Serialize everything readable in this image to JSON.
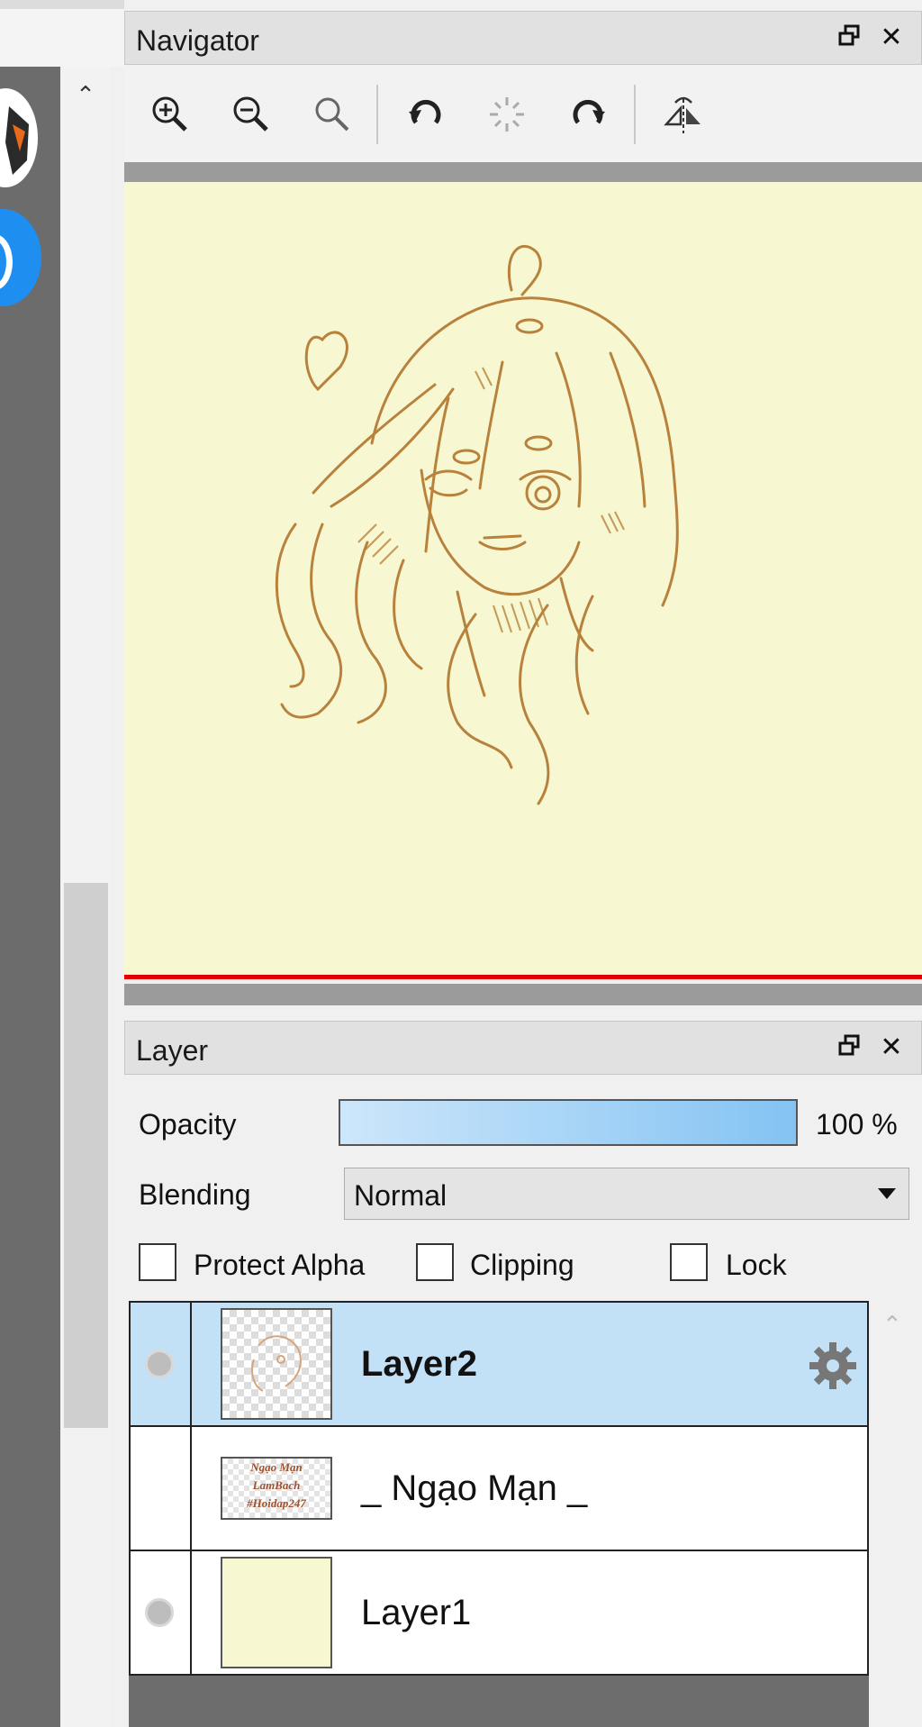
{
  "navigator": {
    "title": "Navigator",
    "toolbar": [
      {
        "icon": "zoom-in-icon"
      },
      {
        "icon": "zoom-out-icon"
      },
      {
        "icon": "zoom-reset-icon"
      },
      {
        "icon": "rotate-left-icon"
      },
      {
        "icon": "rotate-reset-icon"
      },
      {
        "icon": "rotate-right-icon"
      },
      {
        "icon": "flip-horizontal-icon"
      }
    ],
    "canvas_background": "#f7f7d2",
    "sketch_color": "#b8823d"
  },
  "layer_panel": {
    "title": "Layer",
    "opacity_label": "Opacity",
    "opacity_value": "100 %",
    "opacity_fraction": 1.0,
    "blending_label": "Blending",
    "blending_value": "Normal",
    "protect_alpha_label": "Protect Alpha",
    "clipping_label": "Clipping",
    "lock_label": "Lock",
    "layers": [
      {
        "name": "Layer2",
        "selected": true,
        "visible": true,
        "settings_icon": "gear-icon"
      },
      {
        "name": "_ Ngạo Mạn _",
        "selected": false,
        "visible": false
      },
      {
        "name": "Layer1",
        "selected": false,
        "visible": true
      }
    ],
    "watermark_text": [
      "Ngạo Mạn",
      "LamBach",
      "#Hoidap247"
    ]
  },
  "colors": {
    "selected_row": "#c2e1f6",
    "accent_red": "#e00000",
    "opacity_bar_start": "#cde6fa",
    "opacity_bar_end": "#84c3f3"
  }
}
